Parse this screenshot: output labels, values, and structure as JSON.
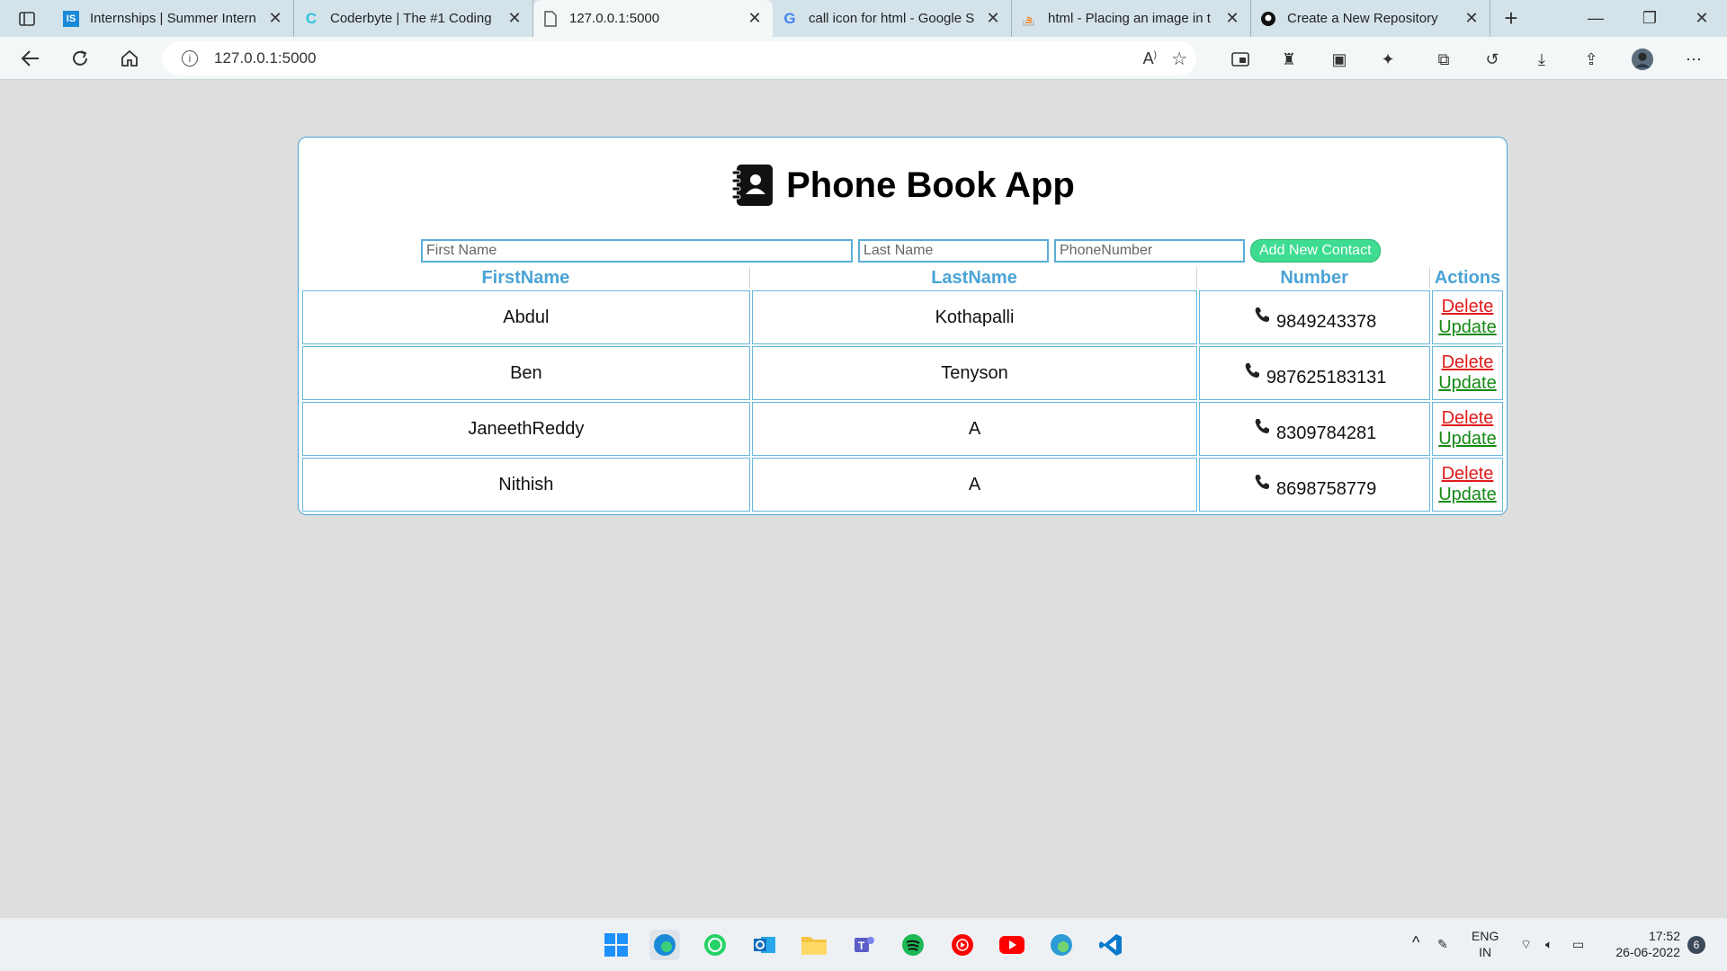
{
  "browser": {
    "tabs": [
      {
        "title": "Internships | Summer Intern",
        "favicon": "IS",
        "favicon_color": "#1a8ad8"
      },
      {
        "title": "Coderbyte | The #1 Coding",
        "favicon": "C",
        "favicon_color": "#2ec0e0"
      },
      {
        "title": "127.0.0.1:5000",
        "favicon": "page-icon",
        "favicon_color": "#555555"
      },
      {
        "title": "call icon for html - Google S",
        "favicon": "G",
        "favicon_color": "#4285f4"
      },
      {
        "title": "html - Placing an image in t",
        "favicon": "stackoverflow-icon",
        "favicon_color": "#f48024"
      },
      {
        "title": "Create a New Repository",
        "favicon": "github-icon",
        "favicon_color": "#111111"
      }
    ],
    "active_tab_index": 2,
    "url": "127.0.0.1:5000"
  },
  "app": {
    "title": "Phone Book App",
    "form": {
      "first_name_placeholder": "First Name",
      "last_name_placeholder": "Last Name",
      "phone_placeholder": "PhoneNumber",
      "add_button_label": "Add New Contact"
    },
    "table": {
      "headers": [
        "FirstName",
        "LastName",
        "Number",
        "Actions"
      ],
      "rows": [
        {
          "first": "Abdul",
          "last": "Kothapalli",
          "number": "9849243378"
        },
        {
          "first": "Ben",
          "last": "Tenyson",
          "number": "987625183131"
        },
        {
          "first": "JaneethReddy",
          "last": "A",
          "number": "8309784281"
        },
        {
          "first": "Nithish",
          "last": "A",
          "number": "8698758779"
        }
      ],
      "delete_label": "Delete",
      "update_label": "Update"
    },
    "colors": {
      "header_text": "#4aa3d6",
      "delete_link": "#e01b1b",
      "update_link": "#158a15",
      "add_button": "#3ddc91"
    }
  },
  "taskbar": {
    "language_line1": "ENG",
    "language_line2": "IN",
    "time": "17:52",
    "date": "26-06-2022",
    "notification_count": "6"
  }
}
